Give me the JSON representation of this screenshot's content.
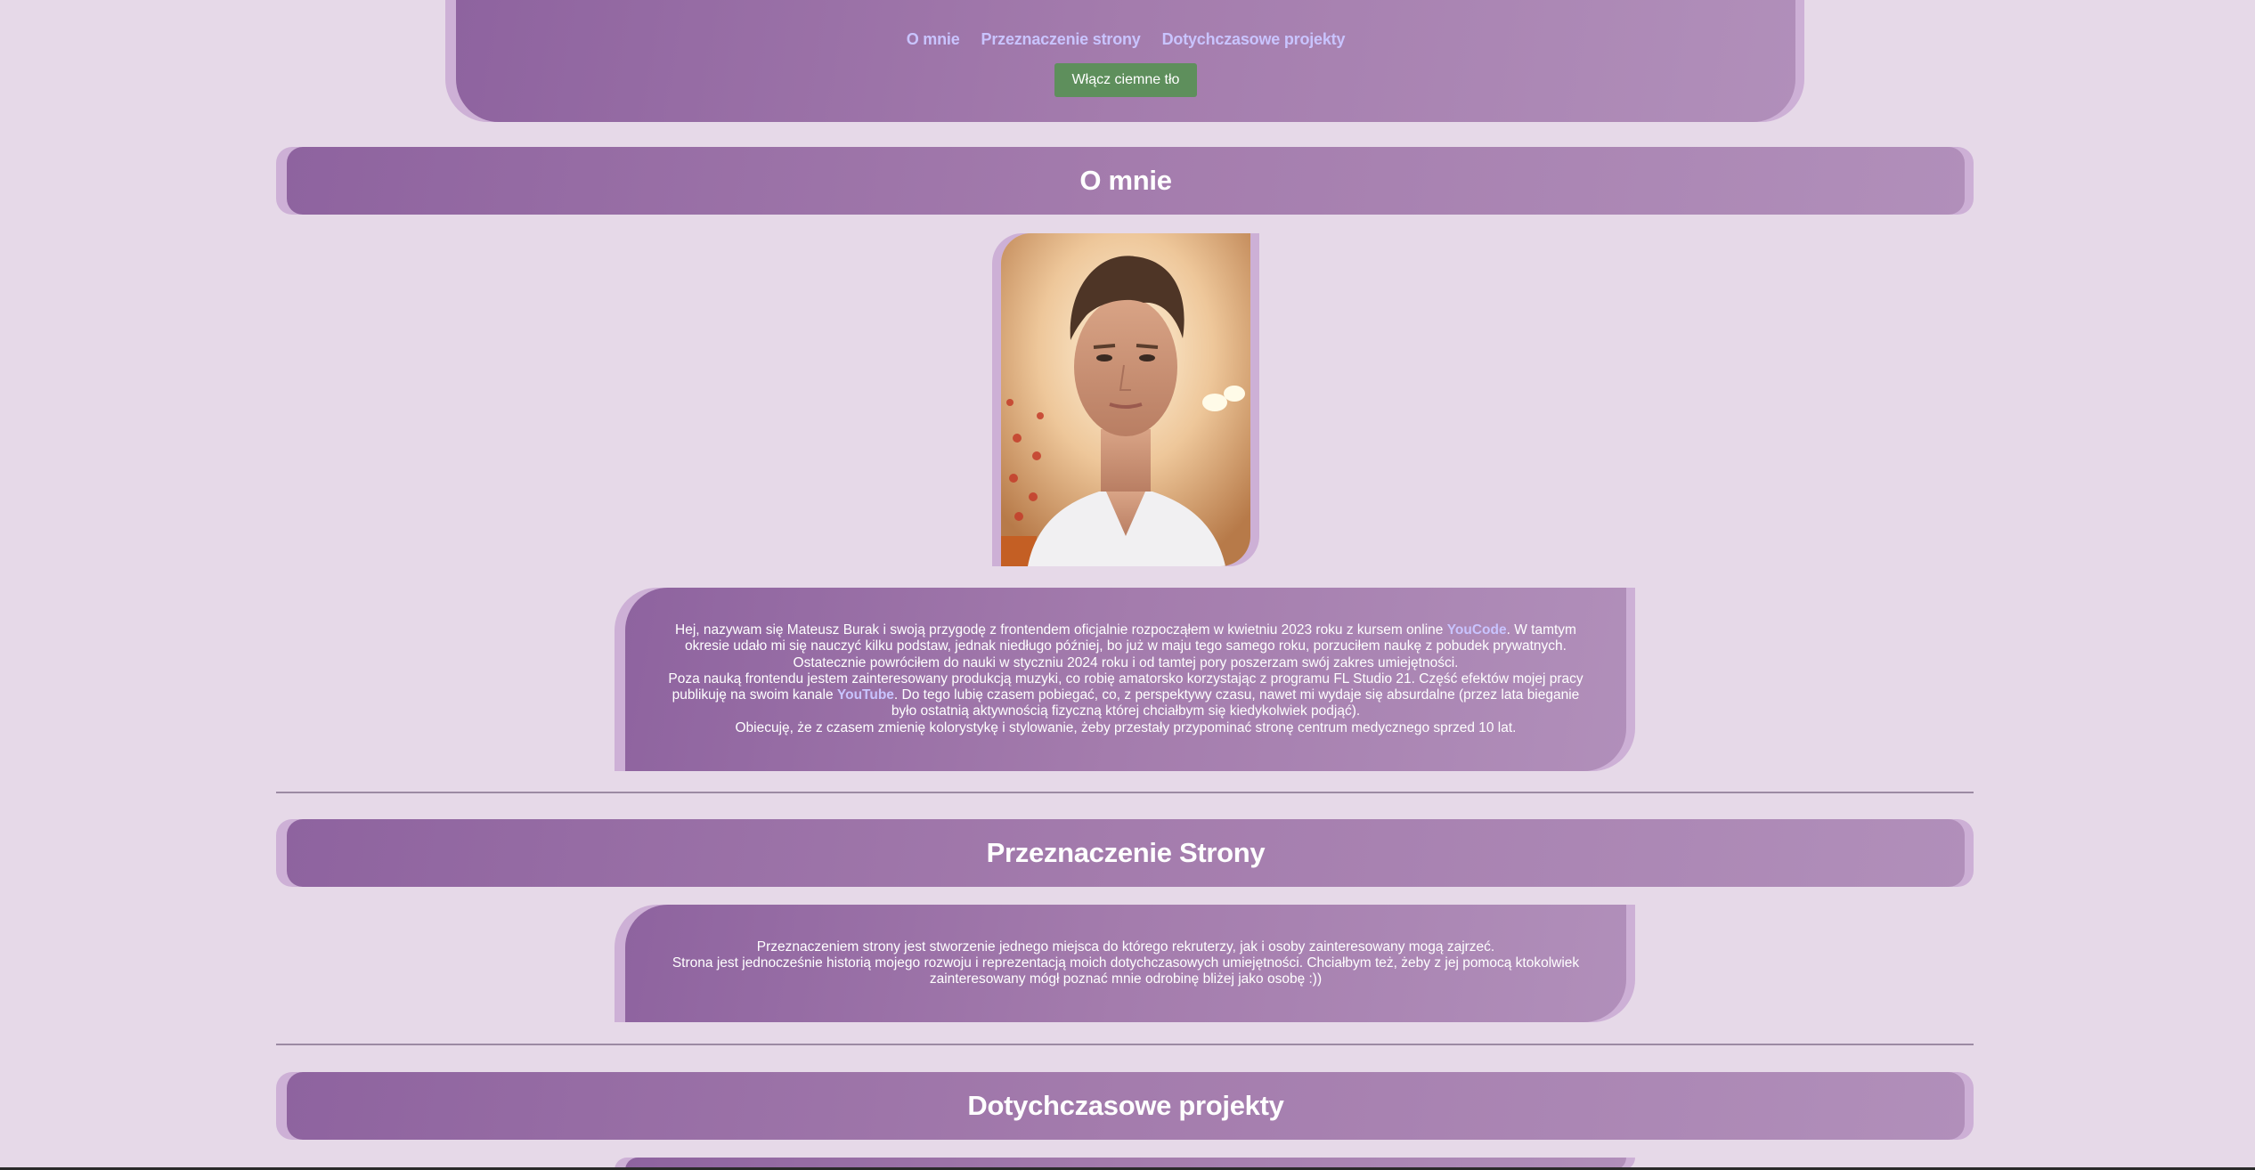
{
  "nav": {
    "items": [
      "O mnie",
      "Przeznaczenie strony",
      "Dotychczasowe projekty"
    ],
    "theme_button": "Włącz ciemne tło",
    "link_color": "#c9c4ff",
    "button_color": "#5e8f5c"
  },
  "about": {
    "title": "O mnie",
    "photo_alt": "portrait-photo",
    "p1_a": "Hej, nazywam się Mateusz Burak i swoją przygodę z frontendem oficjalnie rozpocząłem w kwietniu 2023 roku z kursem online ",
    "p1_link": "YouCode",
    "p1_b": ". W tamtym okresie udało mi się nauczyć kilku podstaw, jednak niedługo później, bo już w maju tego samego roku, porzuciłem naukę z pobudek prywatnych.",
    "p2": "Ostatecznie powróciłem do nauki w styczniu 2024 roku i od tamtej pory poszerzam swój zakres umiejętności.",
    "p3_a": "Poza nauką frontendu jestem zainteresowany produkcją muzyki, co robię amatorsko korzystając z programu FL Studio 21. Część efektów mojej pracy publikuję na swoim kanale ",
    "p3_link": "YouTube",
    "p3_b": ". Do tego lubię czasem pobiegać, co, z perspektywy czasu, nawet mi wydaje się absurdalne (przez lata bieganie było ostatnią aktywnością fizyczną której chciałbym się kiedykolwiek podjąć).",
    "p4": "Obiecuję, że z czasem zmienię kolorystykę i stylowanie, żeby przestały przypominać stronę centrum medycznego sprzed 10 lat."
  },
  "purpose": {
    "title": "Przeznaczenie Strony",
    "p1": "Przeznaczeniem strony jest stworzenie jednego miejsca do którego rekruterzy, jak i osoby zainteresowany mogą zajrzeć.",
    "p2": "Strona jest jednocześnie historią mojego rozwoju i reprezentacją moich dotychczasowych umiejętności. Chciałbym też, żeby z jej pomocą ktokolwiek zainteresowany mógł poznać mnie odrobinę bliżej jako osobę :))"
  },
  "projects": {
    "title": "Dotychczasowe projekty"
  },
  "colors": {
    "background": "#e6d9e8",
    "panel_start": "#8e639f",
    "panel_end": "#b18fba",
    "panel_shadow": "#cdb0d6"
  }
}
